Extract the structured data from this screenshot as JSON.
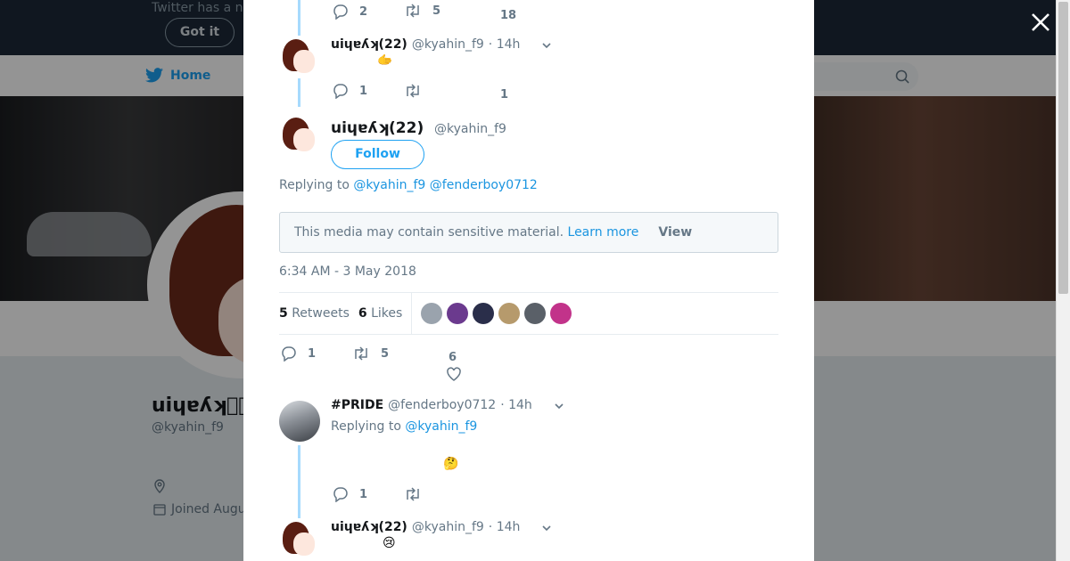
{
  "background": {
    "banner_text": "Twitter has a n",
    "got_it": "Got it",
    "nav_home": "Home",
    "profile_name": "uiɥɐʎʞ",
    "profile_name_suffix": "⃝⃝",
    "profile_handle": "@kyahin_f9",
    "joined": "Joined Augu"
  },
  "colors": {
    "accent": "#1da1f2",
    "thread": "#a6dafd",
    "link": "#1b95e0"
  },
  "thread_top": {
    "reply_count": "2",
    "retweet_count": "5",
    "like_count": "18"
  },
  "tweet2": {
    "name": "uiɥɐʎʞ(22)",
    "handle": "@kyahin_f9",
    "time": "· 14h",
    "text": "🫱",
    "reply_count": "1",
    "like_count": "1"
  },
  "main_tweet": {
    "name": "uiɥɐʎʞ(22)",
    "handle": "@kyahin_f9",
    "follow": "Follow",
    "replying_prefix": "Replying to",
    "reply_to_1": "@kyahin_f9",
    "reply_to_2": "@fenderboy0712",
    "sensitive_text": "This media may contain sensitive material.",
    "learn_more": "Learn more",
    "view": "View",
    "timestamp": "6:34 AM - 3 May 2018",
    "retweets_num": "5",
    "retweets_label": "Retweets",
    "likes_num": "6",
    "likes_label": "Likes",
    "reply_count": "1",
    "retweet_count": "5",
    "like_count": "6"
  },
  "reply1": {
    "name": "#PRIDE",
    "handle": "@fenderboy0712",
    "time": "· 14h",
    "replying_prefix": "Replying to",
    "reply_to": "@kyahin_f9",
    "text": "🤔",
    "reply_count": "1"
  },
  "reply2": {
    "name": "uiɥɐʎʞ(22)",
    "handle": "@kyahin_f9",
    "time": "· 14h",
    "text": "😢"
  }
}
